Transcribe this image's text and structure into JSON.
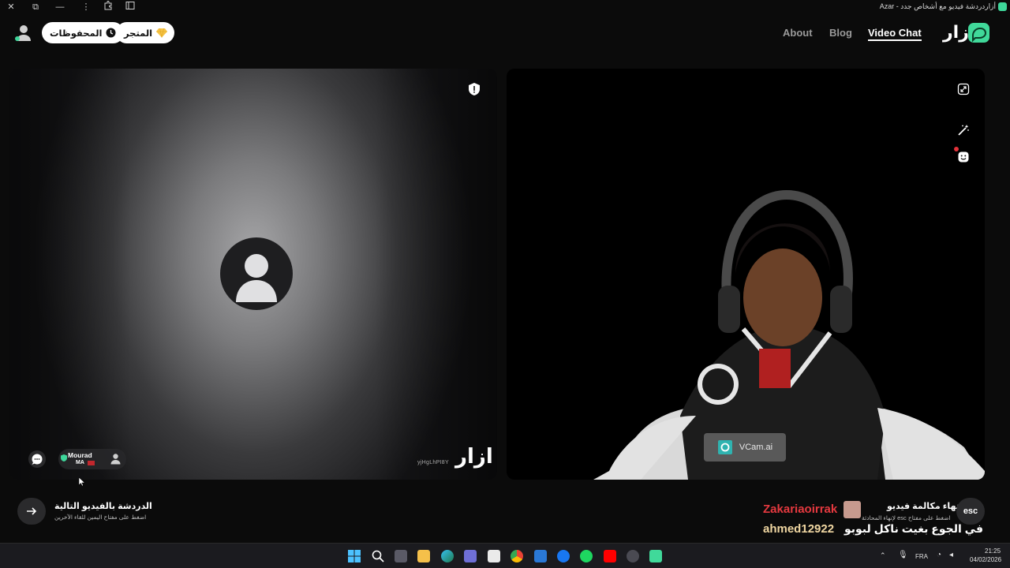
{
  "window": {
    "title": "أزاردردشة فيديو مع أشخاص جدد - Azar",
    "controls": [
      "close",
      "restore",
      "minimize",
      "more",
      "extensions",
      "sidebar"
    ]
  },
  "header": {
    "saved_label": "المحفوظات",
    "store_label": "المتجر",
    "nav": [
      "About",
      "Blog",
      "Video Chat"
    ],
    "active_nav": "Video Chat",
    "logo_text": "ازار",
    "brand_color": "#40d99a"
  },
  "left_panel": {
    "peer_name": "Mourad",
    "peer_country": "MA",
    "session_id": "yjHgLhPI8Y",
    "logo_text": "ازار"
  },
  "right_panel": {
    "watermark": "VCam.ai"
  },
  "footer": {
    "next_title": "الدردشة بالفيديو التالية",
    "next_sub": "اضغط على مفتاح اليمين للقاء الآخرين",
    "end_title": "إنهاء مكالمة فيديو",
    "end_sub": "اضغط على مفتاح esc لإنهاء المحادثة",
    "esc_label": "esc"
  },
  "stream_overlay": {
    "user1": "Zakariaoirrak",
    "user2": "ahmed12922",
    "message": "في الجوع بغيت ناكل لبوبو"
  },
  "taskbar": {
    "language": "FRA",
    "time": "21:25",
    "date": "04/02/2026"
  }
}
